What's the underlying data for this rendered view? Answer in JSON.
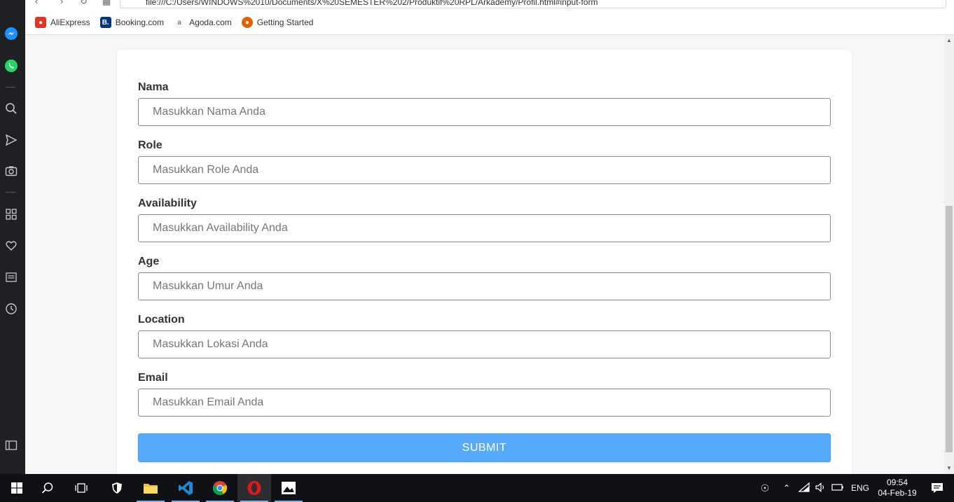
{
  "browser": {
    "address": "file:///C:/Users/WINDOWS%2010/Documents/X%20SEMESTER%202/Produktif%20RPL/Arkademy/Profil.html#input-form",
    "bookmarks": [
      {
        "label": "AliExpress",
        "icon": "aliexpress-icon",
        "color": "#e43225"
      },
      {
        "label": "Booking.com",
        "icon": "booking-icon",
        "color": "#003580"
      },
      {
        "label": "Agoda.com",
        "icon": "agoda-icon",
        "color": "#888888"
      },
      {
        "label": "Getting Started",
        "icon": "firefox-icon",
        "color": "#e66000"
      }
    ]
  },
  "form": {
    "fields": [
      {
        "label": "Nama",
        "placeholder": "Masukkan Nama Anda",
        "value": ""
      },
      {
        "label": "Role",
        "placeholder": "Masukkan Role Anda",
        "value": ""
      },
      {
        "label": "Availability",
        "placeholder": "Masukkan Availability Anda",
        "value": ""
      },
      {
        "label": "Age",
        "placeholder": "Masukkan Umur Anda",
        "value": ""
      },
      {
        "label": "Location",
        "placeholder": "Masukkan Lokasi Anda",
        "value": ""
      },
      {
        "label": "Email",
        "placeholder": "Masukkan Email Anda",
        "value": ""
      }
    ],
    "submit_label": "SUBMIT"
  },
  "colors": {
    "submit": "#57a9fb",
    "taskbar": "#101114",
    "sidebar": "#1f2024"
  },
  "taskbar": {
    "language": "ENG",
    "time": "09:54",
    "date": "04-Feb-19"
  }
}
